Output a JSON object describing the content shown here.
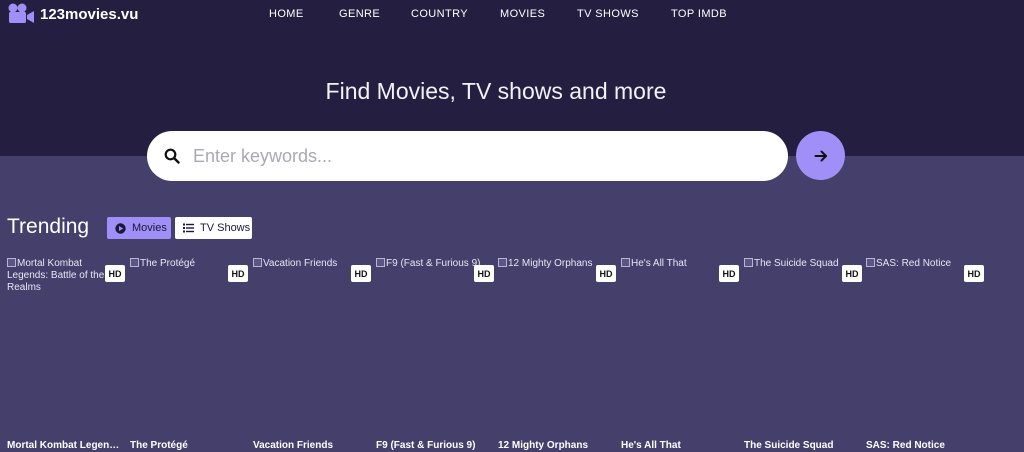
{
  "brand": {
    "name": "123movies.vu",
    "logo_icon": "camera-icon"
  },
  "nav": [
    "HOME",
    "GENRE",
    "COUNTRY",
    "MOVIES",
    "TV SHOWS",
    "TOP IMDB"
  ],
  "hero": {
    "headline": "Find Movies, TV shows and more",
    "search_placeholder": "Enter keywords...",
    "search_icon": "search-icon",
    "submit_icon": "arrow-right-icon"
  },
  "trending": {
    "title": "Trending",
    "tabs": [
      {
        "label": "Movies",
        "icon": "play-circle-icon",
        "active": true
      },
      {
        "label": "TV Shows",
        "icon": "list-icon",
        "active": false
      }
    ],
    "badge": "HD",
    "cards": [
      {
        "alt": "Mortal Kombat Legends: Battle of the Realms",
        "title": "Mortal Kombat Legends: Battle of the Realms"
      },
      {
        "alt": "The Protégé",
        "title": "The Protégé"
      },
      {
        "alt": "Vacation Friends",
        "title": "Vacation Friends"
      },
      {
        "alt": "F9 (Fast & Furious 9)",
        "title": "F9 (Fast & Furious 9)"
      },
      {
        "alt": "12 Mighty Orphans",
        "title": "12 Mighty Orphans"
      },
      {
        "alt": "He's All That",
        "title": "He's All That"
      },
      {
        "alt": "The Suicide Squad",
        "title": "The Suicide Squad"
      },
      {
        "alt": "SAS: Red Notice",
        "title": "SAS: Red Notice"
      }
    ]
  },
  "colors": {
    "hero_bg": "#241f41",
    "page_bg": "#453f6c",
    "accent": "#9f8ff6"
  }
}
